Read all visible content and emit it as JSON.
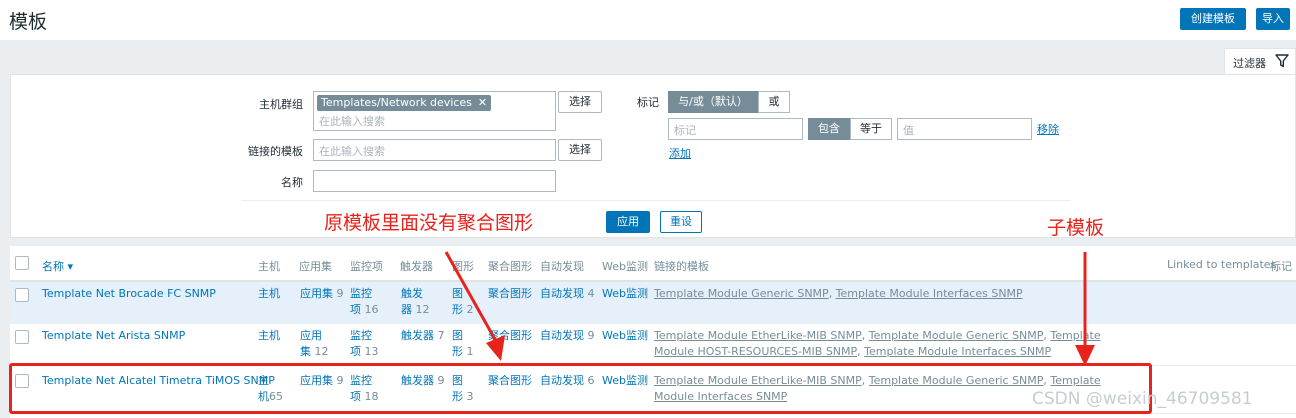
{
  "header": {
    "title": "模板",
    "create_button": "创建模板",
    "import_button": "导入"
  },
  "filter": {
    "tab_label": "过滤器",
    "host_group_label": "主机群组",
    "host_group_chip": "Templates/Network devices",
    "host_group_placeholder": "在此输入搜索",
    "select_label": "选择",
    "linked_templates_label": "链接的模板",
    "linked_templates_placeholder": "在此输入搜索",
    "name_label": "名称",
    "tags_label": "标记",
    "and_or_label": "与/或（默认）",
    "or_label": "或",
    "tag_placeholder": "标记",
    "contains_label": "包含",
    "equals_label": "等于",
    "value_placeholder": "值",
    "remove_label": "移除",
    "add_label": "添加",
    "apply_label": "应用",
    "reset_label": "重设"
  },
  "table": {
    "columns": [
      "名称 ▾",
      "主机",
      "应用集",
      "监控项",
      "触发器",
      "图形",
      "聚合图形",
      "自动发现",
      "Web监测",
      "链接的模板",
      "Linked to templates",
      "标记"
    ],
    "rows": [
      {
        "name": "Template Net Brocade FC SNMP",
        "hosts": "主机",
        "hosts_count": "",
        "apps": "应用集",
        "apps_count": "9",
        "items_1": "监控",
        "items_2": "项",
        "items_count": "16",
        "triggers_1": "触发",
        "triggers_2": "器",
        "triggers_count": "12",
        "graphs_1": "图",
        "graphs_2": "形",
        "graphs_count": "2",
        "screens": "聚合图形",
        "discovery": "自动发现",
        "discovery_count": "4",
        "web": "Web监测",
        "linked": [
          "Template Module Generic SNMP",
          "Template Module Interfaces SNMP"
        ]
      },
      {
        "name": "Template Net Arista SNMP",
        "hosts": "主机",
        "hosts_count": "",
        "apps_1": "应用",
        "apps_2": "集",
        "apps_count": "12",
        "items_1": "监控",
        "items_2": "项",
        "items_count": "13",
        "triggers": "触发器",
        "triggers_count": "7",
        "graphs_1": "图",
        "graphs_2": "形",
        "graphs_count": "1",
        "screens": "聚合图形",
        "discovery": "自动发现",
        "discovery_count": "9",
        "web": "Web监测",
        "linked": [
          "Template Module EtherLike-MIB SNMP",
          "Template Module Generic SNMP",
          "Template Module HOST-RESOURCES-MIB SNMP",
          "Template Module Interfaces SNMP"
        ]
      },
      {
        "name": "Template Net Alcatel Timetra TiMOS SNMP",
        "hosts_1": "主",
        "hosts_2": "机",
        "hosts_count": "65",
        "apps": "应用集",
        "apps_count": "9",
        "items_1": "监控",
        "items_2": "项",
        "items_count": "18",
        "triggers": "触发器",
        "triggers_count": "9",
        "graphs_1": "图",
        "graphs_2": "形",
        "graphs_count": "3",
        "screens": "聚合图形",
        "discovery": "自动发现",
        "discovery_count": "6",
        "web": "Web监测",
        "linked": [
          "Template Module EtherLike-MIB SNMP",
          "Template Module Generic SNMP",
          "Template Module Interfaces SNMP"
        ]
      }
    ]
  },
  "annotations": {
    "left_note": "原模板里面没有聚合图形",
    "right_note": "子模板"
  },
  "watermark": "CSDN @weixin_46709581",
  "colors": {
    "accent": "#0275b8",
    "annotation_red": "#e8231c",
    "selected_row": "#e5f0fa"
  }
}
